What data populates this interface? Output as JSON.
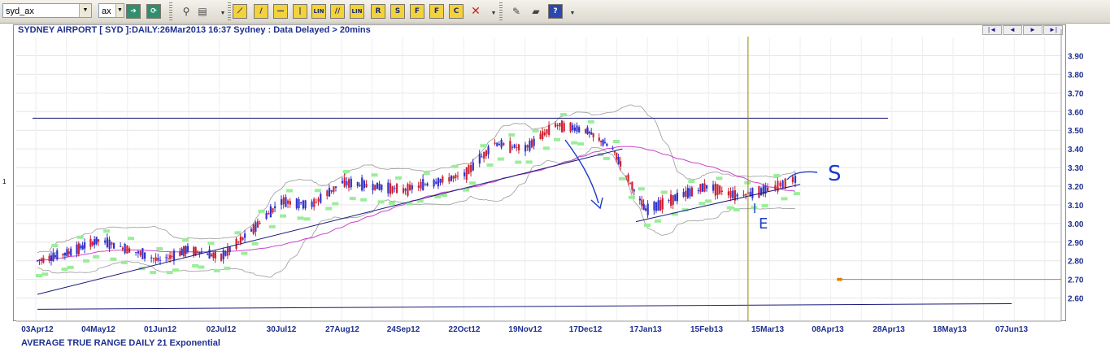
{
  "toolbar": {
    "symbol_value": "syd_ax",
    "exchange_value": "ax",
    "buttons": [
      {
        "name": "go-button",
        "glyph": "➔",
        "style": "g"
      },
      {
        "name": "refresh-button",
        "glyph": "⟳",
        "style": "g"
      },
      {
        "name": "binoculars-button",
        "glyph": "⚲",
        "style": "n"
      },
      {
        "name": "print-button",
        "glyph": "▤",
        "style": "n"
      },
      {
        "name": "draw-trend-button",
        "glyph": "⟋",
        "style": "y"
      },
      {
        "name": "draw-line-button",
        "glyph": "/",
        "style": "y"
      },
      {
        "name": "horizontal-line-button",
        "glyph": "—",
        "style": "y"
      },
      {
        "name": "vertical-line-button",
        "glyph": "|",
        "style": "y"
      },
      {
        "name": "linear-regression-button",
        "glyph": "LIN",
        "style": "y"
      },
      {
        "name": "parallel-lines-button",
        "glyph": "//",
        "style": "y"
      },
      {
        "name": "regression-channel-button",
        "glyph": "LIN",
        "style": "y"
      },
      {
        "name": "retracement-button",
        "glyph": "R",
        "style": "y"
      },
      {
        "name": "speed-lines-button",
        "glyph": "S",
        "style": "y"
      },
      {
        "name": "fibonacci-button",
        "glyph": "F",
        "style": "y"
      },
      {
        "name": "fibonacci-fan-button",
        "glyph": "F",
        "style": "y"
      },
      {
        "name": "cycle-button",
        "glyph": "C",
        "style": "y"
      },
      {
        "name": "delete-drawings-button",
        "glyph": "✕",
        "style": "r"
      },
      {
        "name": "edit-button",
        "glyph": "✎",
        "style": "n"
      },
      {
        "name": "book-button",
        "glyph": "▰",
        "style": "n"
      },
      {
        "name": "help-button",
        "glyph": "?",
        "style": "b"
      }
    ]
  },
  "chart_title": "SYDNEY AIRPORT [ SYD ]:DAILY:26Mar2013 16:37 Sydney : Data Delayed > 20mins",
  "lower_panel_title": "AVERAGE TRUE RANGE DAILY 21 Exponential",
  "axis_marker": "1",
  "nav_buttons": [
    "|◄",
    "◄",
    "►",
    "►|"
  ],
  "colors": {
    "up_candle": "#3333cc",
    "down_candle": "#cc2233",
    "bollinger": "#9a9a9a",
    "moving_average": "#cc44cc",
    "stop_line": "#99ee99",
    "trendline": "#1a1a7a",
    "vertical_marker": "#8a8a00",
    "orange_level": "#e08000",
    "annotation": "#1a3acc"
  },
  "chart_data": {
    "type": "candlestick",
    "title": "SYDNEY AIRPORT [ SYD ]:DAILY:26Mar2013 16:37 Sydney : Data Delayed > 20mins",
    "ylim": [
      2.5,
      3.98
    ],
    "y_ticks": [
      "2.60",
      "2.70",
      "2.80",
      "2.90",
      "3.00",
      "3.10",
      "3.20",
      "3.30",
      "3.40",
      "3.50",
      "3.60",
      "3.70",
      "3.80",
      "3.90"
    ],
    "x_ticks": [
      "03Apr12",
      "04May12",
      "01Jun12",
      "02Jul12",
      "30Jul12",
      "27Aug12",
      "24Sep12",
      "22Oct12",
      "19Nov12",
      "17Dec12",
      "17Jan13",
      "15Feb13",
      "15Mar13",
      "08Apr13",
      "28Apr13",
      "18May13",
      "07Jun13"
    ],
    "price_path": [
      [
        "03Apr12",
        2.8
      ],
      [
        "18Apr12",
        2.84
      ],
      [
        "04May12",
        2.91
      ],
      [
        "18May12",
        2.86
      ],
      [
        "01Jun12",
        2.8
      ],
      [
        "15Jun12",
        2.86
      ],
      [
        "02Jul12",
        2.82
      ],
      [
        "16Jul12",
        2.96
      ],
      [
        "30Jul12",
        3.12
      ],
      [
        "13Aug12",
        3.1
      ],
      [
        "27Aug12",
        3.22
      ],
      [
        "10Sep12",
        3.2
      ],
      [
        "24Sep12",
        3.18
      ],
      [
        "08Oct12",
        3.22
      ],
      [
        "22Oct12",
        3.26
      ],
      [
        "05Nov12",
        3.43
      ],
      [
        "19Nov12",
        3.4
      ],
      [
        "03Dec12",
        3.53
      ],
      [
        "17Dec12",
        3.5
      ],
      [
        "31Dec12",
        3.4
      ],
      [
        "10Jan13",
        3.2
      ],
      [
        "17Jan13",
        3.07
      ],
      [
        "01Feb13",
        3.14
      ],
      [
        "15Feb13",
        3.2
      ],
      [
        "01Mar13",
        3.15
      ],
      [
        "15Mar13",
        3.18
      ],
      [
        "26Mar13",
        3.24
      ]
    ],
    "horizontal_lines": [
      3.565,
      2.7
    ],
    "trendlines": [
      {
        "from": [
          "03Apr12",
          2.62
        ],
        "to": [
          "05Jan13",
          3.4
        ]
      },
      {
        "from": [
          "03Apr12",
          2.54
        ],
        "to": [
          "07Jun13",
          2.57
        ]
      },
      {
        "from": [
          "12Jan13",
          3.01
        ],
        "to": [
          "28Mar13",
          3.21
        ]
      }
    ],
    "vertical_marker": "06Mar13",
    "annotations": [
      "S",
      "E"
    ]
  }
}
